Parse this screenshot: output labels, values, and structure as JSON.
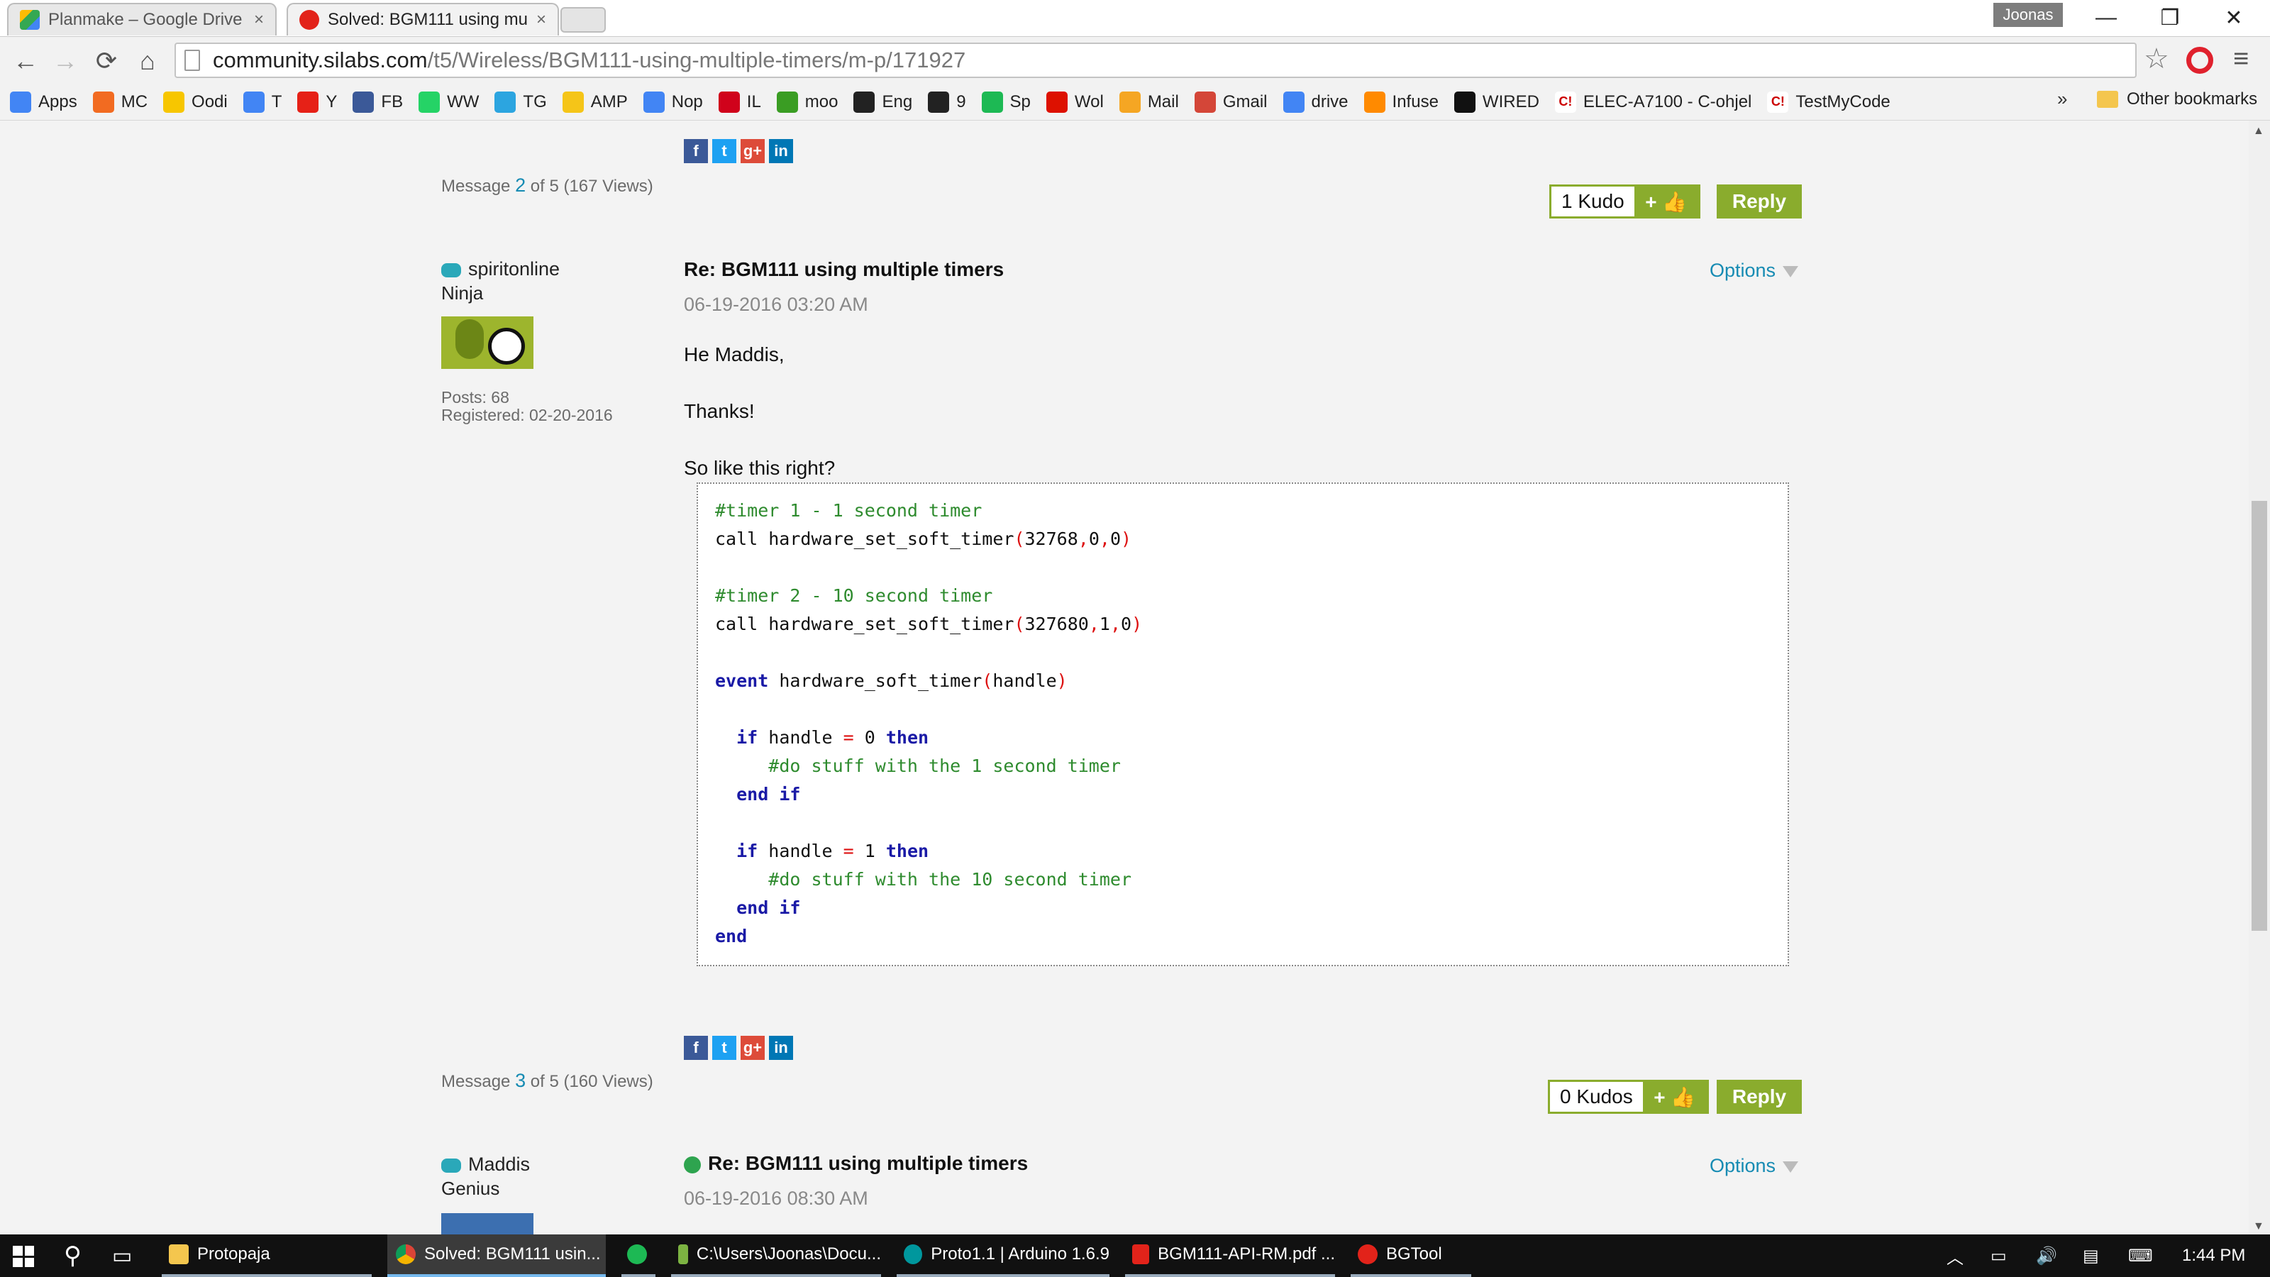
{
  "browser": {
    "tabs": [
      {
        "title": "Planmake – Google Drive",
        "close": "×"
      },
      {
        "title": "Solved: BGM111 using mu",
        "close": "×"
      }
    ],
    "profile": "Joonas",
    "window_controls": {
      "minimize": "—",
      "restore": "❐",
      "close": "✕"
    },
    "url_host": "community.silabs.com",
    "url_path": "/t5/Wireless/BGM111-using-multiple-timers/m-p/171927",
    "bookmarks": [
      {
        "label": "Apps",
        "icon": "apps-grid-icon",
        "color": "#4285f4"
      },
      {
        "label": "MC",
        "icon": "mc-icon",
        "color": "#f26b21"
      },
      {
        "label": "Oodi",
        "icon": "oodi-icon",
        "color": "#f7c600"
      },
      {
        "label": "T",
        "icon": "translate-icon",
        "color": "#4285f4"
      },
      {
        "label": "Y",
        "icon": "youtube-icon",
        "color": "#e62117"
      },
      {
        "label": "FB",
        "icon": "facebook-icon",
        "color": "#3b5998"
      },
      {
        "label": "WW",
        "icon": "whatsapp-icon",
        "color": "#25d366"
      },
      {
        "label": "TG",
        "icon": "telegram-icon",
        "color": "#2ca5e0"
      },
      {
        "label": "AMP",
        "icon": "amp-icon",
        "color": "#f5c518"
      },
      {
        "label": "Nop",
        "icon": "google-icon",
        "color": "#4285f4"
      },
      {
        "label": "IL",
        "icon": "il-icon",
        "color": "#d0021b"
      },
      {
        "label": "moo",
        "icon": "moodle-icon",
        "color": "#3a9d23"
      },
      {
        "label": "Eng",
        "icon": "eng-icon",
        "color": "#222222"
      },
      {
        "label": "9",
        "icon": "ninegag-icon",
        "color": "#222222"
      },
      {
        "label": "Sp",
        "icon": "spotify-icon",
        "color": "#1db954"
      },
      {
        "label": "Wol",
        "icon": "wolfram-icon",
        "color": "#dd1100"
      },
      {
        "label": "Mail",
        "icon": "mail-icon",
        "color": "#f5a623"
      },
      {
        "label": "Gmail",
        "icon": "gmail-icon",
        "color": "#d44638"
      },
      {
        "label": "drive",
        "icon": "google-icon",
        "color": "#4285f4"
      },
      {
        "label": "Infuse",
        "icon": "infuse-icon",
        "color": "#ff8a00"
      },
      {
        "label": "WIRED",
        "icon": "wired-icon",
        "color": "#111111"
      },
      {
        "label": "ELEC-A7100 - C-ohjel",
        "icon": "course-icon",
        "color": "#ffffff"
      },
      {
        "label": "TestMyCode",
        "icon": "course-icon",
        "color": "#ffffff"
      }
    ],
    "more": "»",
    "other_bookmarks": "Other bookmarks"
  },
  "post2": {
    "message_prefix": "Message",
    "message_number": "2",
    "message_suffix": "of 5 (167 Views)",
    "kudo_count": "1 Kudo",
    "kudo_give": "+ 👍",
    "reply": "Reply"
  },
  "post3": {
    "author": "spiritonline",
    "rank": "Ninja",
    "posts": "Posts: 68",
    "registered": "Registered: 02-20-2016",
    "subject": "Re: BGM111 using multiple timers",
    "date": "06-19-2016 03:20 AM",
    "options": "Options",
    "greeting": "He Maddis,",
    "thanks": "Thanks!",
    "question": "So like this right?",
    "message_prefix": "Message",
    "message_number": "3",
    "message_suffix": "of 5 (160 Views)",
    "kudo_count": "0 Kudos",
    "kudo_give": "+ 👍",
    "reply": "Reply"
  },
  "code": {
    "l1": "#timer 1 - 1 second timer",
    "l2_a": "call hardware_set_soft_timer",
    "l2_b": "(",
    "l2_c": "32768",
    "l2_d": ",",
    "l2_e": "0",
    "l2_f": ",",
    "l2_g": "0",
    "l2_h": ")",
    "l3": "#timer 2 - 10 second timer",
    "l4_a": "call hardware_set_soft_timer",
    "l4_b": "(",
    "l4_c": "327680",
    "l4_d": ",",
    "l4_e": "1",
    "l4_f": ",",
    "l4_g": "0",
    "l4_h": ")",
    "l5_kw": "event",
    "l5_a": " hardware_soft_timer",
    "l5_b": "(",
    "l5_c": "handle",
    "l5_d": ")",
    "if": "if",
    "handle": " handle ",
    "eq": "=",
    "zero": " 0 ",
    "one": " 1 ",
    "then": "then",
    "c1": "#do stuff with the 1 second timer",
    "c2": "#do stuff with the 10 second timer",
    "end": "end",
    "end_if_if": " if"
  },
  "post4": {
    "author": "Maddis",
    "rank": "Genius",
    "subject": "Re: BGM111 using multiple timers",
    "date": "06-19-2016 08:30 AM",
    "options": "Options"
  },
  "taskbar": {
    "items": [
      {
        "label": "Protopaja"
      },
      {
        "label": "Solved: BGM111 usin..."
      },
      {
        "label": "C:\\Users\\Joonas\\Docu..."
      },
      {
        "label": "Proto1.1 | Arduino 1.6.9"
      },
      {
        "label": "BGM111-API-RM.pdf ..."
      },
      {
        "label": "BGTool"
      }
    ],
    "clock": "1:44 PM"
  }
}
